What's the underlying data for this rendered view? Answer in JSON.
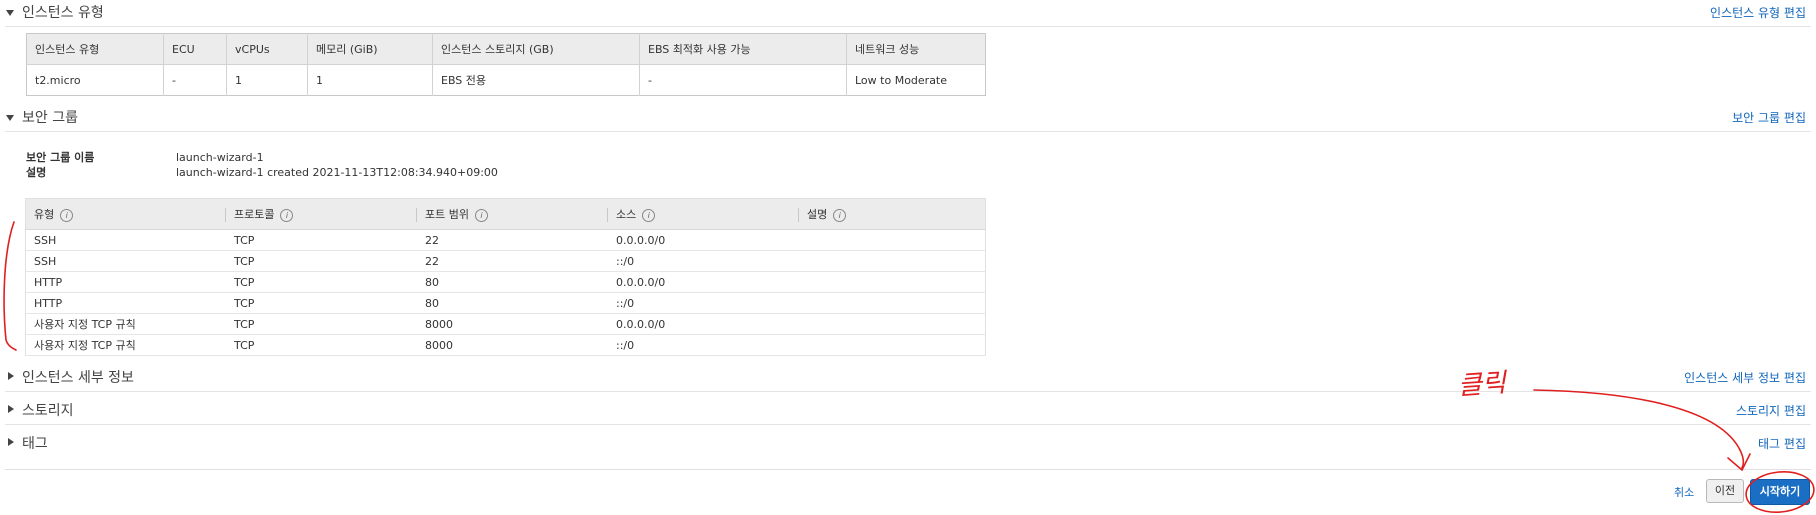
{
  "sections": {
    "instance_type": {
      "title": "인스턴스 유형",
      "edit": "인스턴스 유형 편집"
    },
    "security_group": {
      "title": "보안 그룹",
      "edit": "보안 그룹 편집"
    },
    "instance_details": {
      "title": "인스턴스 세부 정보",
      "edit": "인스턴스 세부 정보 편집"
    },
    "storage": {
      "title": "스토리지",
      "edit": "스토리지 편집"
    },
    "tags": {
      "title": "태그",
      "edit": "태그 편집"
    }
  },
  "instance_table": {
    "headers": [
      "인스턴스 유형",
      "ECU",
      "vCPUs",
      "메모리 (GiB)",
      "인스턴스 스토리지 (GB)",
      "EBS 최적화 사용 가능",
      "네트워크 성능"
    ],
    "row": [
      "t2.micro",
      "-",
      "1",
      "1",
      "EBS 전용",
      "-",
      "Low to Moderate"
    ]
  },
  "security_group": {
    "name_label": "보안 그룹 이름",
    "name_value": "launch-wizard-1",
    "desc_label": "설명",
    "desc_value": "launch-wizard-1 created 2021-11-13T12:08:34.940+09:00"
  },
  "rules_table": {
    "headers": [
      "유형",
      "프로토콜",
      "포트 범위",
      "소스",
      "설명"
    ],
    "rows": [
      [
        "SSH",
        "TCP",
        "22",
        "0.0.0.0/0",
        ""
      ],
      [
        "SSH",
        "TCP",
        "22",
        "::/0",
        ""
      ],
      [
        "HTTP",
        "TCP",
        "80",
        "0.0.0.0/0",
        ""
      ],
      [
        "HTTP",
        "TCP",
        "80",
        "::/0",
        ""
      ],
      [
        "사용자 지정 TCP 규칙",
        "TCP",
        "8000",
        "0.0.0.0/0",
        ""
      ],
      [
        "사용자 지정 TCP 규칙",
        "TCP",
        "8000",
        "::/0",
        ""
      ]
    ]
  },
  "footer": {
    "cancel": "취소",
    "previous": "이전",
    "launch": "시작하기"
  },
  "annotation": {
    "text": "클릭",
    "color": "#e02020"
  },
  "colors": {
    "link": "#1166bb",
    "primary_button": "#1a6fc4"
  },
  "icons": {
    "expanded": "triangle-down",
    "collapsed": "triangle-right",
    "info": "info-circle"
  }
}
